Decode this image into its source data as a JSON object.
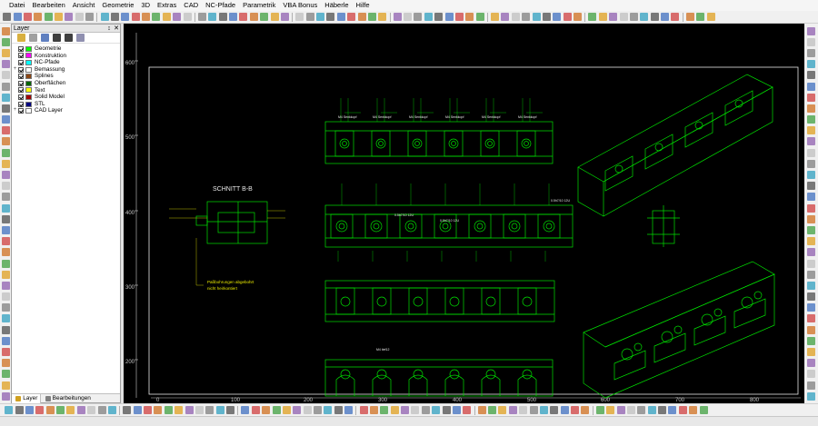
{
  "menu": [
    "Datei",
    "Bearbeiten",
    "Ansicht",
    "Geometrie",
    "3D",
    "Extras",
    "CAD",
    "NC-Pfade",
    "Parametrik",
    "VBA Bonus",
    "Häberle",
    "Hilfe"
  ],
  "layer_panel": {
    "title": "Layer",
    "pin": "↕",
    "close": "✕",
    "layers": [
      {
        "name": "Geometrie",
        "color": "#00ff00",
        "checked": true,
        "expand": ""
      },
      {
        "name": "Konstruktion",
        "color": "#ff00ff",
        "checked": true,
        "expand": ""
      },
      {
        "name": "NC-Pfade",
        "color": "#00ffff",
        "checked": true,
        "expand": ""
      },
      {
        "name": "Bemassung",
        "color": "#ffffff",
        "checked": true,
        "expand": "+"
      },
      {
        "name": "Splines",
        "color": "#8b4513",
        "checked": true,
        "expand": ""
      },
      {
        "name": "Oberflächen",
        "color": "#006400",
        "checked": true,
        "expand": ""
      },
      {
        "name": "Text",
        "color": "#ffff00",
        "checked": true,
        "expand": ""
      },
      {
        "name": "Solid Model",
        "color": "#a00000",
        "checked": true,
        "expand": ""
      },
      {
        "name": "STL",
        "color": "#000080",
        "checked": true,
        "expand": ""
      },
      {
        "name": "CAD Layer",
        "color": "#ffffff",
        "checked": true,
        "expand": "+"
      }
    ],
    "tabs": [
      "Layer",
      "Bearbeitungen"
    ]
  },
  "drawing": {
    "y_ruler": [
      "600",
      "500",
      "400",
      "300",
      "200"
    ],
    "x_ruler": [
      "0",
      "100",
      "200",
      "300",
      "400",
      "500",
      "600",
      "700",
      "800"
    ],
    "section_title": "SCHNITT B-B",
    "note_line1": "Paßbohrungen abgebohrt",
    "note_line2": "nicht heirkontiert",
    "thread_labels": [
      "M4 Senkkopf",
      "M4 Senkkopf",
      "M4 Senkkopf",
      "M4 Senkkopf",
      "M4 Senkkopf",
      "M4 Senkkopf"
    ],
    "dim_labels": [
      "0.5h7/10 12U",
      "0.5h7/10 12U",
      "0.5h7/10 12U",
      "M4 tief12"
    ]
  },
  "colors": {
    "drawing_green": "#00e000",
    "frame_white": "#e8e8e8",
    "dim_yellow": "#e8e800",
    "ruler_text": "#c8c8c8"
  }
}
